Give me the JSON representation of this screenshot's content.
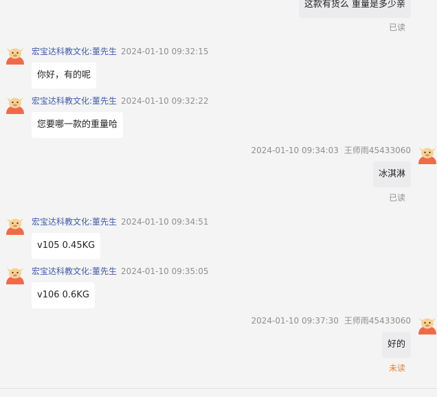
{
  "messages": [
    {
      "direction": "out",
      "text": "这款有货么  重量是多少亲",
      "status": "已读"
    },
    {
      "direction": "in",
      "sender": "宏宝达科教文化:董先生",
      "time": "2024-01-10 09:32:15",
      "text": "你好，有的呢",
      "avatar_icon": "cartoon-mascot-icon"
    },
    {
      "direction": "in",
      "sender": "宏宝达科教文化:董先生",
      "time": "2024-01-10 09:32:22",
      "text": "您要哪一款的重量哈",
      "avatar_icon": "cartoon-mascot-icon"
    },
    {
      "direction": "out",
      "agent": "王师雨45433060",
      "time": "2024-01-10 09:34:03",
      "text": "冰淇淋",
      "status": "已读",
      "avatar_icon": "cartoon-mascot-icon"
    },
    {
      "direction": "in",
      "sender": "宏宝达科教文化:董先生",
      "time": "2024-01-10 09:34:51",
      "text": "v105 0.45KG",
      "avatar_icon": "cartoon-mascot-icon"
    },
    {
      "direction": "in",
      "sender": "宏宝达科教文化:董先生",
      "time": "2024-01-10 09:35:05",
      "text": "v106 0.6KG",
      "avatar_icon": "cartoon-mascot-icon"
    },
    {
      "direction": "out",
      "agent": "王师雨45433060",
      "time": "2024-01-10 09:37:30",
      "text": "好的",
      "status": "未读",
      "avatar_icon": "cartoon-mascot-icon"
    }
  ],
  "colors": {
    "background": "#f4f4f5",
    "incoming_bubble": "#ffffff",
    "outgoing_bubble": "#ececee",
    "sender_name": "#3f5aa8",
    "timestamp": "#8f8f8f",
    "read_status": "#8f8f8f",
    "unread_status": "#e8822e",
    "avatar_body": "#ee6b4a",
    "avatar_face": "#f6d394"
  }
}
